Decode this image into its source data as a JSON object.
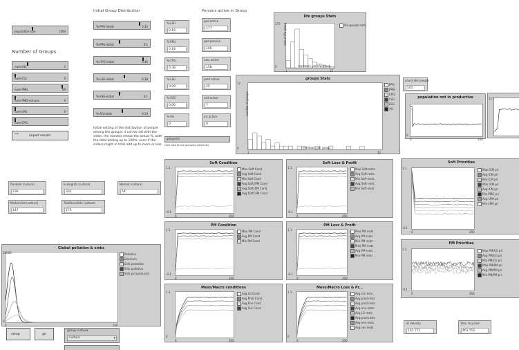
{
  "headings": {
    "initial_group_distribution": "Initial Group Distribution",
    "persons_active_in_group": "Persons active in Group",
    "number_of_groups": "Number of Groups"
  },
  "left_sliders": [
    {
      "label": "population-size",
      "value": "1500",
      "fraction": 0.35
    },
    {
      "label": "num-LSC",
      "value": "2",
      "fraction": 0.25
    },
    {
      "label": "num-CSC",
      "value": "0",
      "fraction": 0.0
    },
    {
      "label": "num-PMG",
      "value": "30",
      "fraction": 0.95
    },
    {
      "label": "num-PMG-init-pos",
      "value": "0",
      "fraction": 0.0
    },
    {
      "label": "num-LPG",
      "value": "0",
      "fraction": 0.0
    },
    {
      "label": "num-CPG",
      "value": "",
      "fraction": 0.0
    }
  ],
  "dist_sliders": [
    {
      "label": "%-PPG-initial",
      "value": "0.32",
      "fraction": 0.85
    },
    {
      "label": "%-PPG-initial",
      "value": "0.1",
      "fraction": 0.45
    },
    {
      "label": "%-CPG-initial",
      "value": "0.46",
      "fraction": 0.92
    },
    {
      "label": "%-LSG-initial",
      "value": "0.18",
      "fraction": 0.55
    },
    {
      "label": "%-ESG-initial",
      "value": "0.1",
      "fraction": 0.45
    },
    {
      "label": "%-AG-initial",
      "value": "0.14",
      "fraction": 0.5
    }
  ],
  "dist_note": "Initial setting of the distribution of people among the groups: it can be set with the slider, the monitor shows the actual %, with the total adding up to 100%, even if the sliders might in total add up to more or less",
  "pct_monitors": [
    {
      "label": "%-LSG",
      "value": "0.16"
    },
    {
      "label": "%-PPG",
      "value": "0.18"
    },
    {
      "label": "%-CPG",
      "value": "0.38"
    },
    {
      "label": "%-LSG",
      "value": "0.09"
    },
    {
      "label": "%-ESG",
      "value": "0.06"
    },
    {
      "label": "%-AG",
      "value": "0"
    }
  ],
  "active_monitors": [
    {
      "label": "ppd active",
      "value": "177"
    },
    {
      "label": "ppd passive",
      "value": "106"
    },
    {
      "label": "cars active",
      "value": "158"
    },
    {
      "label": "pmd active",
      "value": "25"
    },
    {
      "label": "esd active",
      "value": "7"
    },
    {
      "label": "ais active",
      "value": "0"
    }
  ],
  "idle_monitor": {
    "label": "count idle people",
    "value": "505"
  },
  "bottom_monitors": [
    {
      "label": "Random (culture)",
      "value": "236"
    },
    {
      "label": "Ecologists (culture)",
      "value": "302"
    },
    {
      "label": "Normal (culture)",
      "value": "54"
    },
    {
      "label": "Modernists (culture)",
      "value": "147"
    },
    {
      "label": "Traditionalists (culture)",
      "value": "175"
    }
  ],
  "lr_monitors": [
    {
      "label": "LR Velocity",
      "value": "161.771"
    },
    {
      "label": "Total recycled",
      "value": "463.555"
    }
  ],
  "buttons": {
    "import_results": "import results",
    "run_label": "run",
    "setup": "setup",
    "go": "go"
  },
  "chooser": {
    "label": "group-culture",
    "value": "culture"
  },
  "grouplist": {
    "label": "group-list",
    "note": "(See note to see grouping elements)"
  },
  "plots": {
    "life_groups": {
      "title": "life groups Stats",
      "ylabel": "size of life group",
      "xlabel": "members per life group",
      "ymax": "172",
      "ymin": "0",
      "xmin": "1",
      "xmax": "12",
      "legend": [
        "life-groups.com"
      ]
    },
    "groups_stats": {
      "title": "groups Stats",
      "ylabel": "number of groups",
      "xlabel": "members per group",
      "ymax": "12",
      "ymin": "0",
      "xmin": "1",
      "xmax": "12",
      "legend": [
        "PPG",
        "PMG",
        "CPG",
        "LSG",
        "ESG",
        "AG"
      ]
    },
    "population_not_productive": {
      "title": "population not in productive",
      "ymin": "0",
      "xmin": "0",
      "xmax": "200"
    },
    "right_partial": {
      "ymax": "117"
    },
    "global_pollution": {
      "title": "Global pollution & sinks",
      "ymax": "20000",
      "ymin": "0",
      "xmin": "0",
      "xmax": "200",
      "legend": [
        "Pollution",
        "Emission",
        "Sink potential",
        "Sink pollution",
        "Sink pol produced"
      ]
    },
    "soft_condition": {
      "title": "Soft Condition",
      "ymax": "1.1",
      "ymin": "-0.1",
      "xmin": "0",
      "xmax": "200",
      "legend": [
        "Max Soft Cond",
        "Avg Soft Cond",
        "Min Soft Cond",
        "Avg SoftCPM Cond",
        "Avg SoftLPM Cond",
        "Avg SoftCSM Cond"
      ]
    },
    "soft_loss": {
      "title": "Soft Loss & Profit",
      "ymax": "1.1",
      "ymin": "-0.1",
      "xmin": "0",
      "xmax": "200",
      "legend": [
        "Max Soft-rests",
        "Avg Soft-rests",
        "Min Soft-rests",
        "Avg Soft-rests",
        "Min Soft-rests"
      ]
    },
    "soft_priorities": {
      "title": "Soft Priorities",
      "ymax": "1.1",
      "ymin": "-0.1",
      "xmin": "0",
      "xmax": "200",
      "legend": [
        "Max ICM pri",
        "Avg ICM pri",
        "Min ICM pri",
        "Max ICM pri",
        "Avg ICM pri",
        "Min PMG pri",
        "Avg LPM pri",
        "Min LPM pri"
      ]
    },
    "pm_condition": {
      "title": "PM Condition",
      "ymax": "1.1",
      "ymin": "-0.1",
      "xmin": "0",
      "xmax": "200",
      "legend": [
        "Max PM Cond",
        "Avg PM Cond",
        "Min PM Cond"
      ]
    },
    "pm_loss": {
      "title": "PM Loss & Profit",
      "ymax": "1.1",
      "ymin": "-0.1",
      "xmin": "0",
      "xmax": "200",
      "legend": [
        "Max PM rests",
        "Avg PM rests",
        "Min PM rests",
        "Max PM rests",
        "Avg PM rests",
        "Min PM rests"
      ]
    },
    "pm_priorities": {
      "title": "PM Priorities",
      "ymax": "1.1",
      "ymin": "-0.1",
      "xmin": "0",
      "xmax": "200",
      "legend": [
        "Max PM/CG pri",
        "Avg PM/CG pri",
        "Min PM/CG pri",
        "Max PM/PM pri",
        "Avg PM/PM pri",
        "Min PM/PM pri"
      ]
    },
    "meso_conditions": {
      "title": "Meso/Macro conditions",
      "ymax": "1.1",
      "ymin": "0",
      "xmin": "0",
      "xmax": "200",
      "legend": [
        "Avg LG Cond",
        "Avg Prod Cond",
        "Avg Env Cond",
        "Avg Soc Cond"
      ]
    },
    "meso_loss": {
      "title": "Meso/Macro Loss & Pr...",
      "ymax": "1.1",
      "ymin": "0",
      "xmin": "0",
      "xmax": "200",
      "legend": [
        "Avg LG rests",
        "Avg prod rests",
        "Avg prod rests",
        "Avg env rests",
        "Avg LG rests",
        "Avg prod rests",
        "Avg env rests",
        "Avg soc rests"
      ]
    }
  },
  "colors": {
    "plot_bg": "#cfcfcf",
    "line_dark": "#222222",
    "line_mid": "#777777",
    "line_light": "#aaaaaa"
  }
}
